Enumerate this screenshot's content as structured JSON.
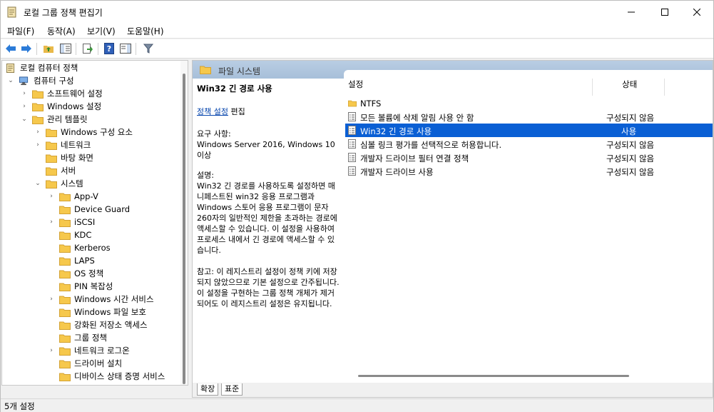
{
  "window": {
    "title": "로컬 그룹 정책 편집기",
    "minimize_icon": "minimize-icon",
    "maximize_icon": "maximize-icon",
    "close_icon": "close-icon"
  },
  "menu": [
    {
      "label": "파일(F)"
    },
    {
      "label": "동작(A)"
    },
    {
      "label": "보기(V)"
    },
    {
      "label": "도움말(H)"
    }
  ],
  "toolbar": [
    "back-arrow-icon",
    "forward-arrow-icon",
    "up-folder-icon",
    "show-hide-tree-icon",
    "export-list-icon",
    "help-icon",
    "show-hide-action-pane-icon",
    "filter-icon"
  ],
  "tree": {
    "items": [
      {
        "label": "로컬 컴퓨터 정책"
      },
      {
        "label": "컴퓨터 구성"
      },
      {
        "label": "소프트웨어 설정"
      },
      {
        "label": "Windows 설정"
      },
      {
        "label": "관리 템플릿"
      },
      {
        "label": "Windows 구성 요소"
      },
      {
        "label": "네트워크"
      },
      {
        "label": "바탕 화면"
      },
      {
        "label": "서버"
      },
      {
        "label": "시스템"
      },
      {
        "label": "App-V"
      },
      {
        "label": "Device Guard"
      },
      {
        "label": "iSCSI"
      },
      {
        "label": "KDC"
      },
      {
        "label": "Kerberos"
      },
      {
        "label": "LAPS"
      },
      {
        "label": "OS 정책"
      },
      {
        "label": "PIN 복잡성"
      },
      {
        "label": "Windows 시간 서비스"
      },
      {
        "label": "Windows 파일 보호"
      },
      {
        "label": "강화된 저장소 액세스"
      },
      {
        "label": "그룹 정책"
      },
      {
        "label": "네트워크 로그온"
      },
      {
        "label": "드라이버 설치"
      },
      {
        "label": "디바이스 상태 증명 서비스"
      }
    ]
  },
  "breadcrumb": {
    "label": "파일 시스템"
  },
  "extended": {
    "title": "Win32 긴 경로 사용",
    "edit_link": "정책 설정",
    "edit_suffix": " 편집",
    "requirements_label": "요구 사항:",
    "requirements": "Windows Server 2016, Windows 10 이상",
    "description_label": "설명:",
    "description": "Win32 긴 경로를 사용하도록 설정하면 매니페스트된 win32 응용 프로그램과 Windows 스토어 응용 프로그램이 문자 260자의 일반적인 제한을 초과하는 경로에 액세스할 수 있습니다. 이 설정을 사용하여 프로세스 내에서 긴 경로에 액세스할 수 있습니다.",
    "note": "참고: 이 레지스트리 설정이 정책 키에 저장되지 않았으므로 기본 설정으로 간주됩니다. 이 설정을 구현하는 그룹 정책 개체가 제거되어도 이 레지스트리 설정은 유지됩니다."
  },
  "list": {
    "columns": {
      "setting": "설정",
      "state": "상태"
    },
    "rows": [
      {
        "name": "NTFS",
        "state": "",
        "icon": "folder-icon"
      },
      {
        "name": "모든 볼륨에 삭제 알림 사용 안 함",
        "state": "구성되지 않음",
        "icon": "policy-setting-icon"
      },
      {
        "name": "Win32 긴 경로 사용",
        "state": "사용",
        "icon": "policy-setting-icon",
        "selected": true
      },
      {
        "name": "심볼 링크 평가를 선택적으로 허용합니다.",
        "state": "구성되지 않음",
        "icon": "policy-setting-icon"
      },
      {
        "name": "개발자 드라이브 필터 연결 정책",
        "state": "구성되지 않음",
        "icon": "policy-setting-icon"
      },
      {
        "name": "개발자 드라이브 사용",
        "state": "구성되지 않음",
        "icon": "policy-setting-icon"
      }
    ]
  },
  "tabs": [
    {
      "label": "확장"
    },
    {
      "label": "표준"
    }
  ],
  "status": {
    "text": "5개 설정"
  },
  "colors": {
    "selection": "#0a5fd4",
    "header_strip": "#b1c7df",
    "folder": "#f6c84c"
  }
}
